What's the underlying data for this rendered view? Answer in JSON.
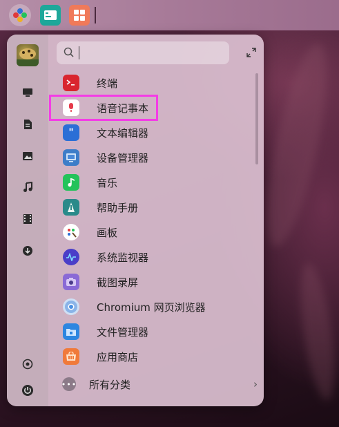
{
  "taskbar": {
    "apps": [
      {
        "name": "launcher-icon"
      },
      {
        "name": "terminal-icon"
      },
      {
        "name": "app-store-icon"
      }
    ]
  },
  "launcher": {
    "search": {
      "placeholder": ""
    },
    "sidebar": [
      "computer-icon",
      "document-icon",
      "image-icon",
      "music-icon",
      "video-icon",
      "download-icon",
      "settings-icon",
      "power-icon"
    ],
    "apps": [
      {
        "label": "终端",
        "icon": "terminal-icon",
        "color": "#d9262f"
      },
      {
        "label": "语音记事本",
        "icon": "voice-note-icon",
        "color": "#ffffff"
      },
      {
        "label": "文本编辑器",
        "icon": "text-editor-icon",
        "color": "#2b6fd6"
      },
      {
        "label": "设备管理器",
        "icon": "device-manager-icon",
        "color": "#3d7dc8"
      },
      {
        "label": "音乐",
        "icon": "music-icon",
        "color": "#23c35a"
      },
      {
        "label": "帮助手册",
        "icon": "help-manual-icon",
        "color": "#2a8a8a"
      },
      {
        "label": "画板",
        "icon": "draw-icon",
        "color": "#ffffff"
      },
      {
        "label": "系统监视器",
        "icon": "system-monitor-icon",
        "color": "#4a3ec8"
      },
      {
        "label": "截图录屏",
        "icon": "screenshot-icon",
        "color": "#8a6ad6"
      },
      {
        "label": "Chromium 网页浏览器",
        "icon": "chromium-icon",
        "color": "#4a90e2"
      },
      {
        "label": "文件管理器",
        "icon": "file-manager-icon",
        "color": "#2d86e0"
      },
      {
        "label": "应用商店",
        "icon": "app-store-icon",
        "color": "#f07a3a"
      }
    ],
    "all_categories": "所有分类",
    "highlight_color": "#f43ce6"
  }
}
